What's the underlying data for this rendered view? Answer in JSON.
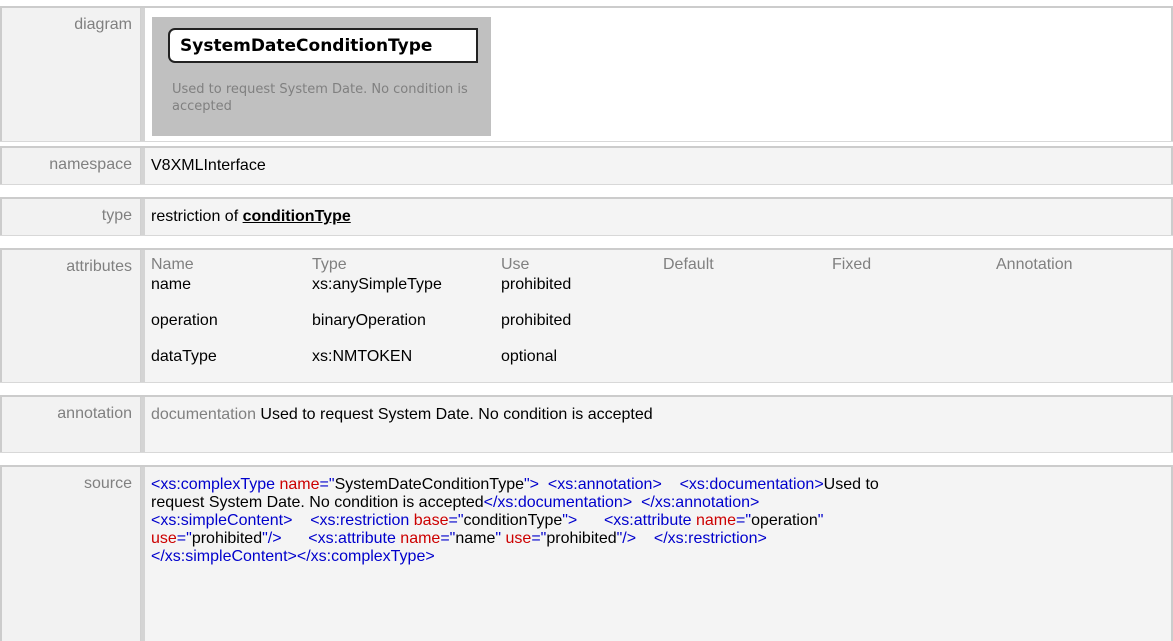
{
  "labels": {
    "diagram": "diagram",
    "namespace": "namespace",
    "type": "type",
    "attributes": "attributes",
    "annotation": "annotation",
    "source": "source"
  },
  "diagram": {
    "node_title": "SystemDateConditionType",
    "node_note": "Used to request System Date. No condition is accepted"
  },
  "namespace": "V8XMLInterface",
  "type": {
    "prefix": "restriction of ",
    "link": "conditionType"
  },
  "attributes": {
    "headers": [
      "Name",
      "Type",
      "Use",
      "Default",
      "Fixed",
      "Annotation"
    ],
    "rows": [
      {
        "name": "name",
        "type": "xs:anySimpleType",
        "use": "prohibited"
      },
      {
        "name": "operation",
        "type": "binaryOperation",
        "use": "prohibited"
      },
      {
        "name": "dataType",
        "type": "xs:NMTOKEN",
        "use": "optional"
      }
    ]
  },
  "annotation": {
    "key": "documentation",
    "text": "Used to request System Date. No condition is accepted"
  },
  "source": {
    "line1": [
      {
        "k": "t",
        "s": "<xs:complexType "
      },
      {
        "k": "a",
        "s": "name"
      },
      {
        "k": "t",
        "s": "=\""
      },
      {
        "k": "v",
        "s": "SystemDateConditionType"
      },
      {
        "k": "t",
        "s": "\">"
      },
      {
        "k": "t",
        "s": "  <xs:annotation>"
      },
      {
        "k": "t",
        "s": "    <xs:documentation>"
      },
      {
        "k": "v",
        "s": "Used to"
      }
    ],
    "line2": [
      {
        "k": "v",
        "s": "request System Date. No condition is accepted"
      },
      {
        "k": "t",
        "s": "</xs:documentation>"
      },
      {
        "k": "t",
        "s": "  </xs:annotation>"
      }
    ],
    "line3": [
      {
        "k": "t",
        "s": "<xs:simpleContent>"
      },
      {
        "k": "t",
        "s": "    <xs:restriction "
      },
      {
        "k": "a",
        "s": "base"
      },
      {
        "k": "t",
        "s": "=\""
      },
      {
        "k": "v",
        "s": "conditionType"
      },
      {
        "k": "t",
        "s": "\">"
      },
      {
        "k": "t",
        "s": "      <xs:attribute "
      },
      {
        "k": "a",
        "s": "name"
      },
      {
        "k": "t",
        "s": "=\""
      },
      {
        "k": "v",
        "s": "operation"
      },
      {
        "k": "t",
        "s": "\""
      }
    ],
    "line4": [
      {
        "k": "a",
        "s": "use"
      },
      {
        "k": "t",
        "s": "=\""
      },
      {
        "k": "v",
        "s": "prohibited"
      },
      {
        "k": "t",
        "s": "\"/>"
      },
      {
        "k": "t",
        "s": "      <xs:attribute "
      },
      {
        "k": "a",
        "s": "name"
      },
      {
        "k": "t",
        "s": "=\""
      },
      {
        "k": "v",
        "s": "name"
      },
      {
        "k": "t",
        "s": "\" "
      },
      {
        "k": "a",
        "s": "use"
      },
      {
        "k": "t",
        "s": "=\""
      },
      {
        "k": "v",
        "s": "prohibited"
      },
      {
        "k": "t",
        "s": "\"/>"
      },
      {
        "k": "t",
        "s": "    </xs:restriction>"
      }
    ],
    "line5": [
      {
        "k": "t",
        "s": "</xs:simpleContent></xs:complexType>"
      }
    ]
  }
}
